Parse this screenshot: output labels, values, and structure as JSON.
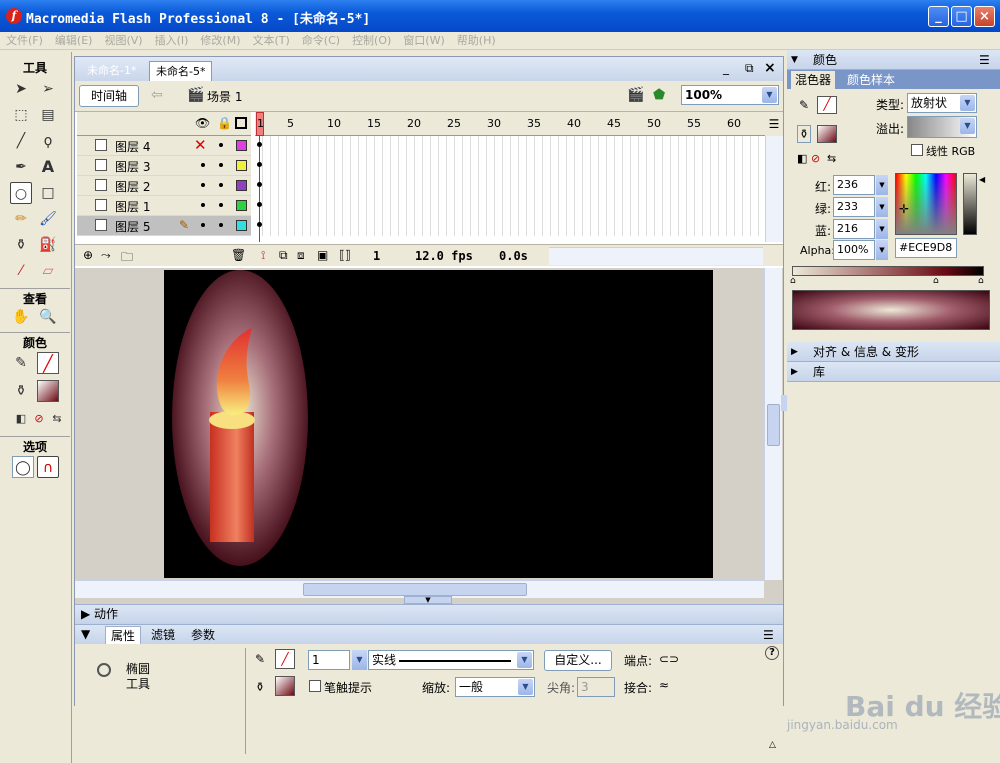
{
  "window": {
    "title": "Macromedia Flash Professional 8 - [未命名-5*]",
    "icon": "flash-app-icon"
  },
  "menu": [
    "文件(F)",
    "编辑(E)",
    "视图(V)",
    "插入(I)",
    "修改(M)",
    "文本(T)",
    "命令(C)",
    "控制(O)",
    "窗口(W)",
    "帮助(H)"
  ],
  "tools": {
    "title": "工具",
    "view_title": "查看",
    "color_title": "颜色",
    "options_title": "选项"
  },
  "doc": {
    "tabs": [
      "未命名-1*",
      "未命名-5*"
    ],
    "timeline_button": "时间轴",
    "scene": "场景 1",
    "zoom": "100%"
  },
  "timeline": {
    "layers": [
      {
        "name": "图层 4",
        "color": "#e040e0",
        "hidden": true
      },
      {
        "name": "图层 3",
        "color": "#f0f040"
      },
      {
        "name": "图层 2",
        "color": "#9040c0"
      },
      {
        "name": "图层 1",
        "color": "#30d040"
      },
      {
        "name": "图层 5",
        "color": "#30e0e0",
        "selected": true
      }
    ],
    "ruler": [
      "1",
      "5",
      "10",
      "15",
      "20",
      "25",
      "30",
      "35",
      "40",
      "45",
      "50",
      "55",
      "60"
    ],
    "current_frame": "1",
    "fps": "12.0 fps",
    "time": "0.0s"
  },
  "panels": {
    "actions": "动作",
    "props_tabs": [
      "属性",
      "滤镜",
      "参数"
    ],
    "tool_name_line1": "椭圆",
    "tool_name_line2": "工具",
    "stroke_width": "1",
    "stroke_style": "实线",
    "custom_button": "自定义...",
    "cap_label": "端点:",
    "hinting_label": "笔触提示",
    "scale_label": "缩放:",
    "scale_value": "一般",
    "miter_label": "尖角:",
    "miter_value": "3",
    "join_label": "接合:"
  },
  "color_panel": {
    "title": "颜色",
    "tabs": [
      "混色器",
      "颜色样本"
    ],
    "type_label": "类型:",
    "type_value": "放射状",
    "overflow_label": "溢出:",
    "linear_rgb": "线性 RGB",
    "red_label": "红:",
    "red": "236",
    "green_label": "绿:",
    "green": "233",
    "blue_label": "蓝:",
    "blue": "216",
    "alpha_label": "Alpha:",
    "alpha": "100%",
    "hex": "#ECE9D8",
    "align_panel": "对齐 & 信息 & 变形",
    "library_panel": "库"
  },
  "watermark": {
    "brand": "Bai du 经验",
    "url": "jingyan.baidu.com"
  }
}
